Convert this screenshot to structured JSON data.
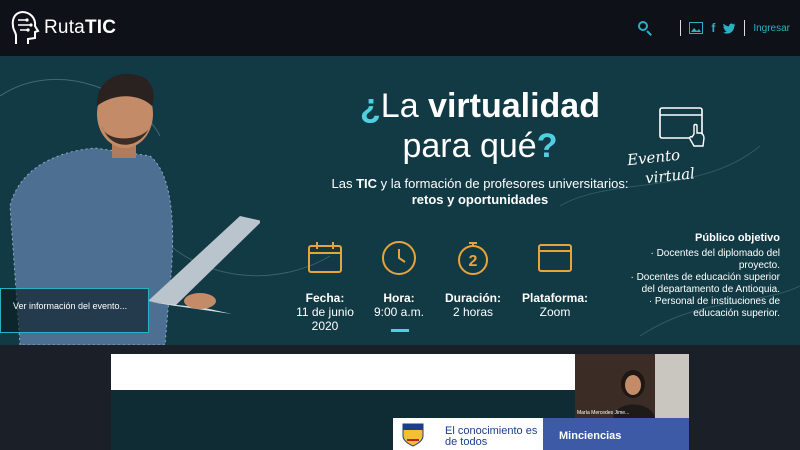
{
  "header": {
    "logo_text_light": "Ruta",
    "logo_text_bold": "TIC",
    "facebook_glyph": "f",
    "login_label": "Ingresar",
    "icons": [
      "search-icon",
      "image-icon",
      "facebook-icon",
      "twitter-icon"
    ]
  },
  "banner": {
    "headline_q_open": "¿",
    "headline_light": "La ",
    "headline_bold": "virtualidad",
    "headline_line2": "para qué",
    "headline_q_close": "?",
    "subtitle_pre": "Las ",
    "subtitle_bold1": "TIC",
    "subtitle_mid": " y la formación de profesores universitarios: ",
    "subtitle_bold2": "retos y oportunidades",
    "event_label_1": "Evento",
    "event_label_2": "virtual",
    "details": [
      {
        "label": "Fecha:",
        "value": "11 de junio 2020",
        "icon": "calendar-icon"
      },
      {
        "label": "Hora:",
        "value": "9:00 a.m.",
        "icon": "clock-icon"
      },
      {
        "label": "Duración:",
        "value": "2 horas",
        "icon": "stopwatch-icon",
        "badge": "2"
      },
      {
        "label": "Plataforma:",
        "value": "Zoom",
        "icon": "window-icon"
      }
    ],
    "audience_title": "Público objetivo",
    "audience": [
      "· Docentes del diplomado del proyecto.",
      "· Docentes de educación superior del departamento de Antioquia.",
      "· Personal de instituciones de educación superior."
    ],
    "overlay_link": "Ver información del evento..."
  },
  "video": {
    "participant_name": "María Mercedes Jime...",
    "footer_text": "El conocimiento es de todos",
    "footer_right": "Minciencias"
  },
  "colors": {
    "accent": "#2bb0c3",
    "banner_bg": "#123a44",
    "icon_gold": "#e8a33b"
  }
}
